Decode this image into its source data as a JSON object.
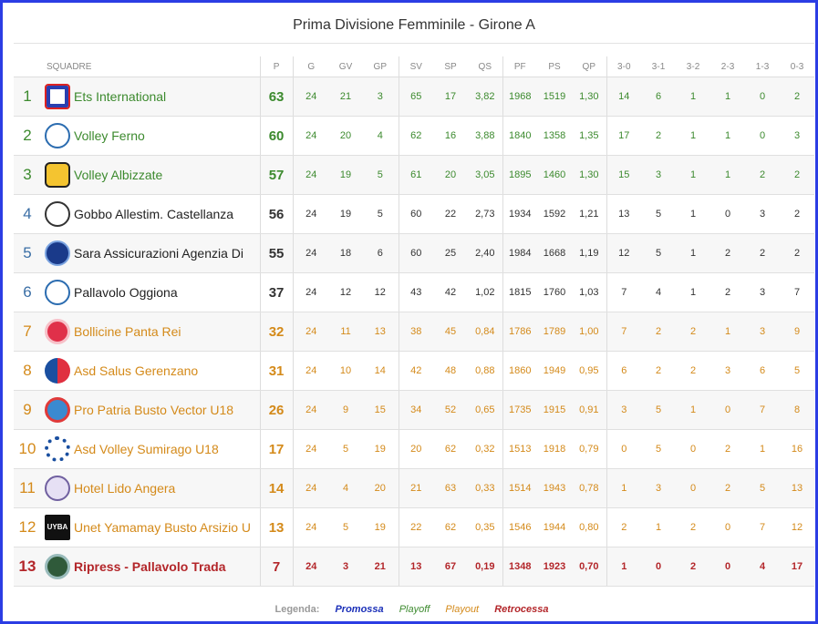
{
  "title": "Prima Divisione Femminile - Girone A",
  "headers": {
    "team": "SQUADRE",
    "cols": [
      "P",
      "G",
      "GV",
      "GP",
      "SV",
      "SP",
      "QS",
      "PF",
      "PS",
      "QP",
      "3-0",
      "3-1",
      "3-2",
      "2-3",
      "1-3",
      "0-3"
    ]
  },
  "colors": {
    "border": "#2b3de4",
    "promossa": "#1a2fb8",
    "playoff": "#3c8a2e",
    "playout": "#d48a1a",
    "retrocessa": "#b3262a"
  },
  "rows": [
    {
      "rank": "1",
      "team": "Ets International",
      "zone": "playoff",
      "logo": "flag-shield-logo",
      "cells": [
        "63",
        "24",
        "21",
        "3",
        "65",
        "17",
        "3,82",
        "1968",
        "1519",
        "1,30",
        "14",
        "6",
        "1",
        "1",
        "0",
        "2"
      ]
    },
    {
      "rank": "2",
      "team": "Volley Ferno",
      "zone": "playoff",
      "logo": "volleyball-logo",
      "cells": [
        "60",
        "24",
        "20",
        "4",
        "62",
        "16",
        "3,88",
        "1840",
        "1358",
        "1,35",
        "17",
        "2",
        "1",
        "1",
        "0",
        "3"
      ]
    },
    {
      "rank": "3",
      "team": "Volley Albizzate",
      "zone": "playoff",
      "logo": "crest-logo",
      "cells": [
        "57",
        "24",
        "19",
        "5",
        "61",
        "20",
        "3,05",
        "1895",
        "1460",
        "1,30",
        "15",
        "3",
        "1",
        "1",
        "2",
        "2"
      ]
    },
    {
      "rank": "4",
      "team": "Gobbo Allestim. Castellanza",
      "zone": "none",
      "logo": "round-ball-logo",
      "cells": [
        "56",
        "24",
        "19",
        "5",
        "60",
        "22",
        "2,73",
        "1934",
        "1592",
        "1,21",
        "13",
        "5",
        "1",
        "0",
        "3",
        "2"
      ]
    },
    {
      "rank": "5",
      "team": "Sara Assicurazioni Agenzia Di",
      "zone": "none",
      "logo": "blue-circle-logo",
      "cells": [
        "55",
        "24",
        "18",
        "6",
        "60",
        "25",
        "2,40",
        "1984",
        "1668",
        "1,19",
        "12",
        "5",
        "1",
        "2",
        "2",
        "2"
      ]
    },
    {
      "rank": "6",
      "team": "Pallavolo Oggiona",
      "zone": "none",
      "logo": "volleyball-logo",
      "cells": [
        "37",
        "24",
        "12",
        "12",
        "43",
        "42",
        "1,02",
        "1815",
        "1760",
        "1,03",
        "7",
        "4",
        "1",
        "2",
        "3",
        "7"
      ]
    },
    {
      "rank": "7",
      "team": "Bollicine Panta Rei",
      "zone": "playout",
      "logo": "red-circle-logo",
      "cells": [
        "32",
        "24",
        "11",
        "13",
        "38",
        "45",
        "0,84",
        "1786",
        "1789",
        "1,00",
        "7",
        "2",
        "2",
        "1",
        "3",
        "9"
      ]
    },
    {
      "rank": "8",
      "team": "Asd Salus Gerenzano",
      "zone": "playout",
      "logo": "blue-red-logo",
      "cells": [
        "31",
        "24",
        "10",
        "14",
        "42",
        "48",
        "0,88",
        "1860",
        "1949",
        "0,95",
        "6",
        "2",
        "2",
        "3",
        "6",
        "5"
      ]
    },
    {
      "rank": "9",
      "team": "Pro Patria Busto Vector U18",
      "zone": "playout",
      "logo": "emblem-logo",
      "cells": [
        "26",
        "24",
        "9",
        "15",
        "34",
        "52",
        "0,65",
        "1735",
        "1915",
        "0,91",
        "3",
        "5",
        "1",
        "0",
        "7",
        "8"
      ]
    },
    {
      "rank": "10",
      "team": "Asd Volley Sumirago U18",
      "zone": "playout",
      "logo": "gear-logo",
      "cells": [
        "17",
        "24",
        "5",
        "19",
        "20",
        "62",
        "0,32",
        "1513",
        "1918",
        "0,79",
        "0",
        "5",
        "0",
        "2",
        "1",
        "16"
      ]
    },
    {
      "rank": "11",
      "team": "Hotel Lido Angera",
      "zone": "playout",
      "logo": "oval-logo",
      "cells": [
        "14",
        "24",
        "4",
        "20",
        "21",
        "63",
        "0,33",
        "1514",
        "1943",
        "0,78",
        "1",
        "3",
        "0",
        "2",
        "5",
        "13"
      ]
    },
    {
      "rank": "12",
      "team": "Unet Yamamay Busto Arsizio U",
      "zone": "playout",
      "logo": "uyba-logo",
      "logo_text": "UYBA",
      "cells": [
        "13",
        "24",
        "5",
        "19",
        "22",
        "62",
        "0,35",
        "1546",
        "1944",
        "0,80",
        "2",
        "1",
        "2",
        "0",
        "7",
        "12"
      ]
    },
    {
      "rank": "13",
      "team": "Ripress - Pallavolo Trada",
      "zone": "retro",
      "logo": "green-round-logo",
      "cells": [
        "7",
        "24",
        "3",
        "21",
        "13",
        "67",
        "0,19",
        "1348",
        "1923",
        "0,70",
        "1",
        "0",
        "2",
        "0",
        "4",
        "17"
      ]
    }
  ],
  "legend": {
    "label": "Legenda:",
    "promossa": "Promossa",
    "playoff": "Playoff",
    "playout": "Playout",
    "retrocessa": "Retrocessa"
  }
}
